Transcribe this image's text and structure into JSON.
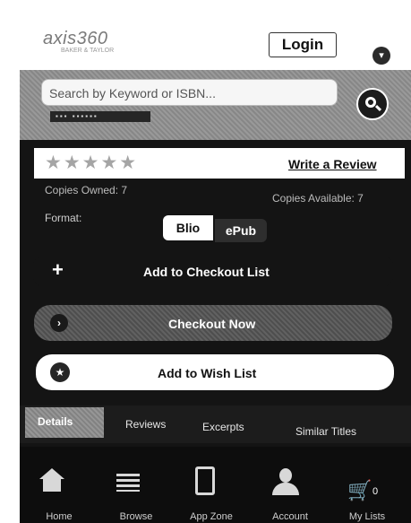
{
  "header": {
    "logo_main": "axis360",
    "logo_sub": "BAKER & TAYLOR",
    "login_label": "Login",
    "menu_icon": "chevron-down-icon"
  },
  "search": {
    "placeholder": "Search by Keyword or ISBN...",
    "icon": "search-icon"
  },
  "book": {
    "cover_strip_text": "▪▪▪ ▪▪▪▪▪▪",
    "stars": "★★★★★",
    "write_review_label": "Write a Review",
    "copies_owned": "Copies Owned: 7",
    "copies_available": "Copies Available: 7",
    "format_label": "Format:",
    "formats": [
      "Blio",
      "ePub"
    ]
  },
  "actions": {
    "add_checkout": "Add to Checkout List",
    "checkout_now": "Checkout Now",
    "add_wishlist": "Add to Wish List"
  },
  "tabs": [
    "Details",
    "Reviews",
    "Excerpts",
    "Similar Titles"
  ],
  "bottom_nav": [
    {
      "label": "Home",
      "icon": "home-icon"
    },
    {
      "label": "Browse",
      "icon": "list-icon"
    },
    {
      "label": "App Zone",
      "icon": "tablet-icon"
    },
    {
      "label": "Account",
      "icon": "person-icon"
    },
    {
      "label": "My Lists",
      "icon": "cart-icon"
    }
  ],
  "cart_count": "0"
}
